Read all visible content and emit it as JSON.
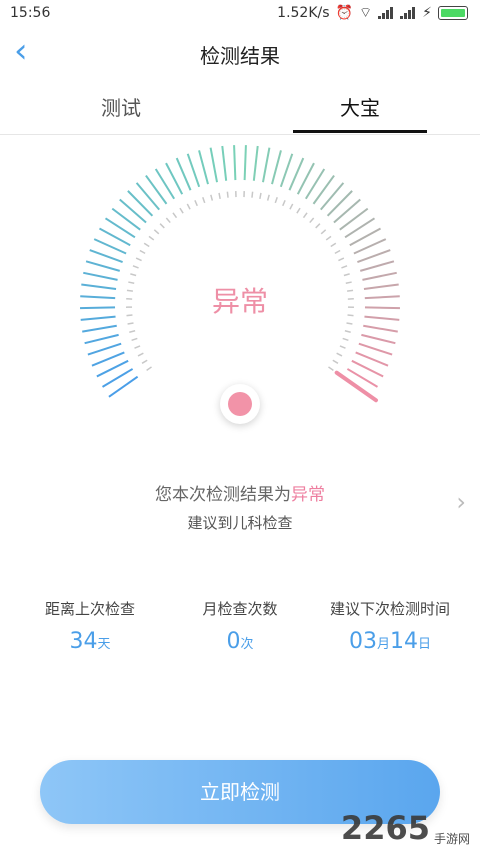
{
  "status_bar": {
    "time": "15:56",
    "speed": "1.52K/s"
  },
  "nav": {
    "back_icon": "chevron-left-icon",
    "title": "检测结果"
  },
  "tabs": [
    {
      "label": "测试",
      "active": false
    },
    {
      "label": "大宝",
      "active": true
    }
  ],
  "gauge": {
    "label": "异常",
    "colors": {
      "start": "#4a9ee8",
      "mid": "#7ad2b6",
      "end": "#ee8fa6"
    }
  },
  "result": {
    "prefix": "您本次检测结果为",
    "status": "异常",
    "advice": "建议到儿科检查"
  },
  "stats": [
    {
      "label": "距离上次检查",
      "value": "34",
      "unit": "天"
    },
    {
      "label": "月检查次数",
      "value": "0",
      "unit": "次"
    },
    {
      "label": "建议下次检测时间",
      "month": "03",
      "month_unit": "月",
      "day": "14",
      "day_unit": "日"
    }
  ],
  "cta": {
    "label": "立即检测"
  },
  "watermark": {
    "brand": "2265",
    "site": "手游网"
  }
}
